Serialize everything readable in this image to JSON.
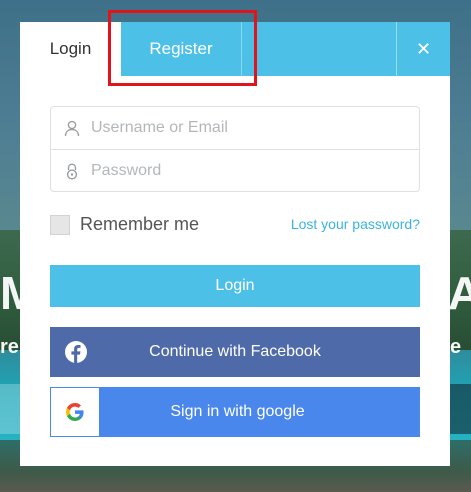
{
  "tabs": {
    "login_label": "Login",
    "register_label": "Register",
    "close_glyph": "✕"
  },
  "form": {
    "username_placeholder": "Username or Email",
    "password_placeholder": "Password",
    "remember_label": "Remember me",
    "lost_password_link": "Lost your password?"
  },
  "buttons": {
    "login_label": "Login",
    "facebook_label": "Continue with Facebook",
    "google_label": "Sign in with google"
  },
  "background": {
    "fragment_left_large": "M",
    "fragment_right_large": "A",
    "fragment_left_small": "re",
    "fragment_right_small": "e"
  },
  "icons": {
    "user": "user-icon",
    "lock": "lock-icon",
    "close": "close-icon",
    "facebook": "facebook-icon",
    "google": "google-icon"
  },
  "colors": {
    "accent": "#4dc0e8",
    "facebook": "#4f6aa9",
    "google": "#4a87ec",
    "link": "#3bb3e1",
    "highlight": "#e0141a"
  }
}
